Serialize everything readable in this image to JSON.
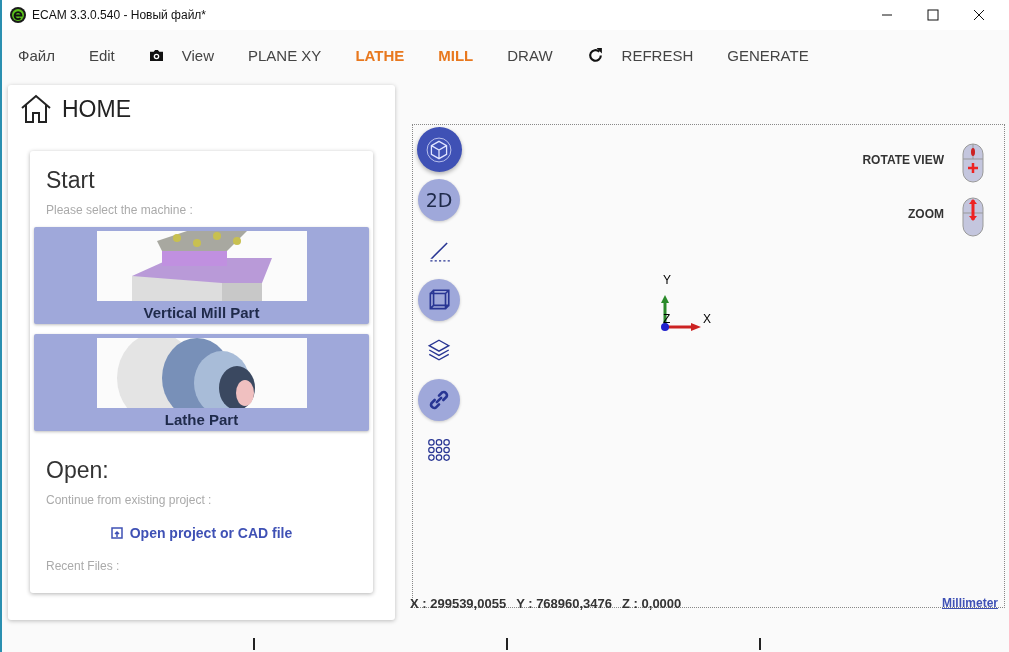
{
  "window": {
    "title": "ECAM 3.3.0.540 - Новый файл*"
  },
  "menu": [
    {
      "kind": "text",
      "label": "Файл",
      "highlighted": false
    },
    {
      "kind": "text",
      "label": "Edit",
      "highlighted": false
    },
    {
      "kind": "camera"
    },
    {
      "kind": "text",
      "label": "View",
      "highlighted": false
    },
    {
      "kind": "text",
      "label": "PLANE XY",
      "highlighted": false
    },
    {
      "kind": "text",
      "label": "LATHE",
      "highlighted": true
    },
    {
      "kind": "text",
      "label": "MILL",
      "highlighted": true
    },
    {
      "kind": "text",
      "label": "DRAW",
      "highlighted": false
    },
    {
      "kind": "refresh"
    },
    {
      "kind": "text",
      "label": "REFRESH",
      "highlighted": false
    },
    {
      "kind": "text",
      "label": "GENERATE",
      "highlighted": false
    }
  ],
  "home": {
    "title": "HOME",
    "start": {
      "heading": "Start",
      "hint": "Please select the machine :",
      "machines": [
        {
          "kind": "mill",
          "label": "Vertical Mill Part"
        },
        {
          "kind": "lathe",
          "label": "Lathe Part"
        }
      ]
    },
    "open": {
      "heading": "Open:",
      "hint": "Continue from existing project :",
      "link": "Open project or CAD file",
      "recent": "Recent Files :"
    }
  },
  "tools": [
    {
      "kind": "cube",
      "selected": true,
      "circled": true
    },
    {
      "kind": "text",
      "label": "2D",
      "selected": false,
      "circled": true
    },
    {
      "kind": "pen",
      "selected": false,
      "circled": false
    },
    {
      "kind": "box",
      "selected": false,
      "circled": true
    },
    {
      "kind": "layers",
      "selected": false,
      "circled": false
    },
    {
      "kind": "link",
      "selected": false,
      "circled": true
    },
    {
      "kind": "grid",
      "selected": false,
      "circled": false
    }
  ],
  "mouse_hints": [
    {
      "kind": "rotate",
      "label": "ROTATE VIEW"
    },
    {
      "kind": "zoom",
      "label": "ZOOM"
    }
  ],
  "axes": {
    "x": "X",
    "y": "Y",
    "z": "Z"
  },
  "status": {
    "x": "X : 299539,0055",
    "y": "Y : 768960,3476",
    "z": "Z : 0,0000",
    "unit": "Millimeter"
  }
}
